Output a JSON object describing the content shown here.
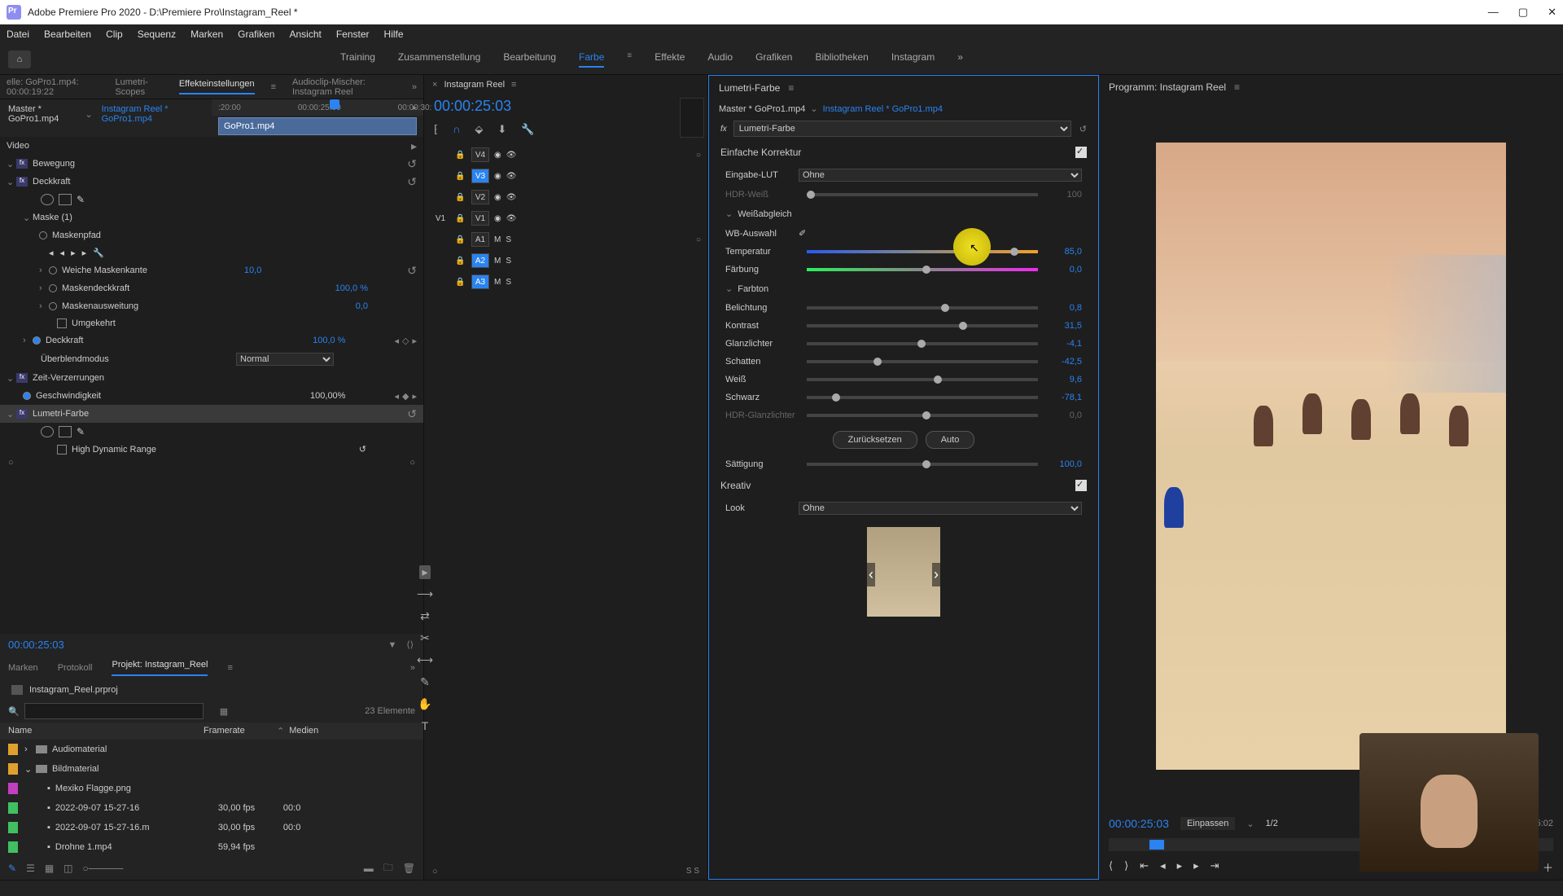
{
  "window": {
    "title": "Adobe Premiere Pro 2020 - D:\\Premiere Pro\\Instagram_Reel *"
  },
  "menu": [
    "Datei",
    "Bearbeiten",
    "Clip",
    "Sequenz",
    "Marken",
    "Grafiken",
    "Ansicht",
    "Fenster",
    "Hilfe"
  ],
  "workspaces": [
    "Training",
    "Zusammenstellung",
    "Bearbeitung",
    "Farbe",
    "Effekte",
    "Audio",
    "Grafiken",
    "Bibliotheken",
    "Instagram"
  ],
  "effect_panel": {
    "tabs": [
      "elle: GoPro1.mp4: 00:00:19:22",
      "Lumetri-Scopes",
      "Effekteinstellungen",
      "Audioclip-Mischer: Instagram Reel"
    ],
    "master": "Master * GoPro1.mp4",
    "sequence": "Instagram Reel * GoPro1.mp4",
    "ruler": {
      "t1": ":20:00",
      "t2": "00:00:25:00",
      "t3": "00:00:30:"
    },
    "clip": "GoPro1.mp4",
    "video_label": "Video",
    "fx": {
      "bewegung": "Bewegung",
      "deckkraft": "Deckkraft",
      "maske": "Maske (1)",
      "maskenpfad": "Maskenpfad",
      "weiche": "Weiche Maskenkante",
      "weiche_v": "10,0",
      "maskdeck": "Maskendeckkraft",
      "maskdeck_v": "100,0 %",
      "maskaus": "Maskenausweitung",
      "maskaus_v": "0,0",
      "umgekehrt": "Umgekehrt",
      "deckkraft2": "Deckkraft",
      "deckkraft2_v": "100,0 %",
      "blend": "Überblendmodus",
      "blend_v": "Normal",
      "zeit": "Zeit-Verzerrungen",
      "gesch": "Geschwindigkeit",
      "gesch_v": "100,00%",
      "lumetri": "Lumetri-Farbe",
      "hdr": "High Dynamic Range"
    },
    "timecode": "00:00:25:03"
  },
  "project": {
    "tabs": [
      "Marken",
      "Protokoll",
      "Projekt: Instagram_Reel"
    ],
    "file": "Instagram_Reel.prproj",
    "count": "23 Elemente",
    "cols": {
      "name": "Name",
      "fr": "Framerate",
      "med": "Medien"
    },
    "items": [
      {
        "color": "#e0a030",
        "name": "Audiomaterial",
        "fr": "",
        "folder": true
      },
      {
        "color": "#e0a030",
        "name": "Bildmaterial",
        "fr": "",
        "folder": true,
        "open": true
      },
      {
        "color": "#c040c0",
        "name": "Mexiko Flagge.png",
        "fr": ""
      },
      {
        "color": "#40c060",
        "name": "2022-09-07 15-27-16",
        "fr": "30,00 fps",
        "med": "00:0"
      },
      {
        "color": "#40c060",
        "name": "2022-09-07 15-27-16.m",
        "fr": "30,00 fps",
        "med": "00:0"
      },
      {
        "color": "#40c060",
        "name": "Drohne 1.mp4",
        "fr": "59,94 fps"
      }
    ]
  },
  "timeline": {
    "name": "Instagram Reel",
    "tc": "00:00:25:03",
    "tracks_v": [
      "V4",
      "V3",
      "V2",
      "V1"
    ],
    "tracks_a": [
      "A1",
      "A2",
      "A3"
    ],
    "footer": "S  S"
  },
  "lumetri": {
    "title": "Lumetri-Farbe",
    "master": "Master * GoPro1.mp4",
    "sequence": "Instagram Reel * GoPro1.mp4",
    "effect": "Lumetri-Farbe",
    "einfache": "Einfache Korrektur",
    "eingabe": "Eingabe-LUT",
    "eingabe_v": "Ohne",
    "hdrweiss": "HDR-Weiß",
    "hdrweiss_v": "100",
    "weissab": "Weißabgleich",
    "wbauswahl": "WB-Auswahl",
    "temperatur": "Temperatur",
    "temperatur_v": "85,0",
    "faerbung": "Färbung",
    "faerbung_v": "0,0",
    "farbton": "Farbton",
    "belichtung": "Belichtung",
    "belichtung_v": "0,8",
    "kontrast": "Kontrast",
    "kontrast_v": "31,5",
    "glanz": "Glanzlichter",
    "glanz_v": "-4,1",
    "schatten": "Schatten",
    "schatten_v": "-42,5",
    "weiss": "Weiß",
    "weiss_v": "9,6",
    "schwarz": "Schwarz",
    "schwarz_v": "-78,1",
    "hdrglanz": "HDR-Glanzlichter",
    "hdrglanz_v": "0,0",
    "reset": "Zurücksetzen",
    "auto": "Auto",
    "saettigung": "Sättigung",
    "saettigung_v": "100,0",
    "kreativ": "Kreativ",
    "look": "Look",
    "look_v": "Ohne"
  },
  "program": {
    "title": "Programm: Instagram Reel",
    "tc": "00:00:25:03",
    "fit": "Einpassen",
    "zoom": "1/2",
    "dur": "00:00:05:02"
  }
}
